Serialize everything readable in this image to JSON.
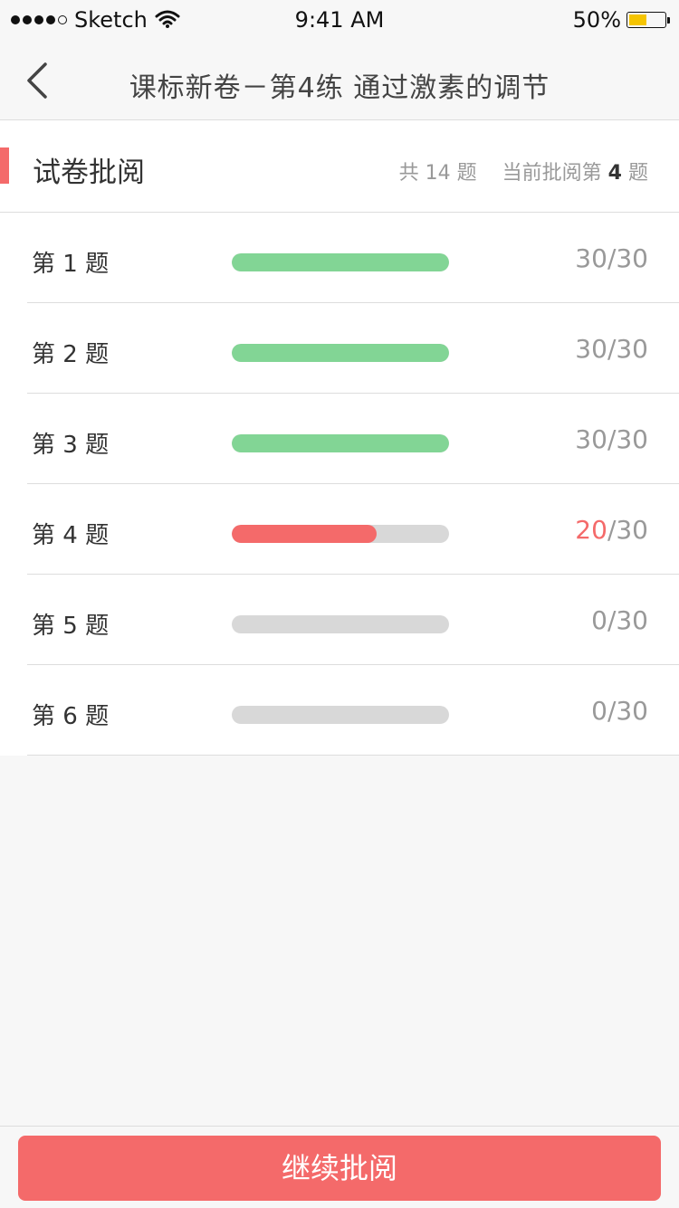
{
  "status_bar": {
    "carrier": "Sketch",
    "time": "9:41 AM",
    "battery_percent": "50%",
    "battery_level": 0.5,
    "signal_dots_filled": 4,
    "signal_dots_total": 5
  },
  "nav": {
    "title": "课标新卷－第4练 通过激素的调节",
    "back_icon": "chevron-left-icon"
  },
  "section": {
    "title": "试卷批阅",
    "total_prefix": "共",
    "total_count": "14",
    "total_suffix": "题",
    "current_prefix": "当前批阅第",
    "current_index": "4",
    "current_suffix": "题"
  },
  "questions": [
    {
      "label": "第 1 题",
      "score": "30",
      "max": "/30",
      "fraction": 1.0,
      "status": "done"
    },
    {
      "label": "第 2 题",
      "score": "30",
      "max": "/30",
      "fraction": 1.0,
      "status": "done"
    },
    {
      "label": "第 3 题",
      "score": "30",
      "max": "/30",
      "fraction": 1.0,
      "status": "done"
    },
    {
      "label": "第 4 题",
      "score": "20",
      "max": "/30",
      "fraction": 0.667,
      "status": "partial"
    },
    {
      "label": "第 5 题",
      "score": "0",
      "max": "/30",
      "fraction": 0,
      "status": "empty"
    },
    {
      "label": "第 6 题",
      "score": "0",
      "max": "/30",
      "fraction": 0,
      "status": "empty"
    }
  ],
  "colors": {
    "accent": "#f46a6a",
    "done": "#82d595",
    "partial": "#f46a6a",
    "track": "#d8d8d8"
  },
  "footer": {
    "continue_label": "继续批阅"
  }
}
